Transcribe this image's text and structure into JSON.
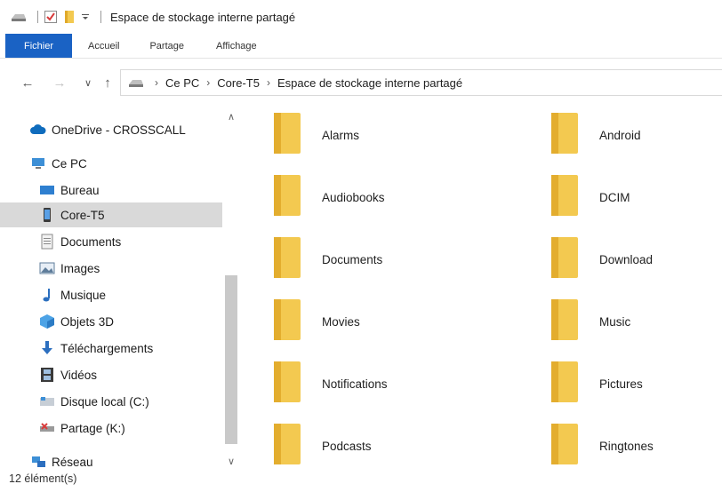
{
  "window": {
    "title": "Espace de stockage interne partagé",
    "quick_access": [
      "drive-icon",
      "properties-check-icon",
      "folder-icon",
      "customize-dropdown-icon"
    ]
  },
  "ribbon": {
    "tabs": [
      {
        "label": "Fichier",
        "active": true
      },
      {
        "label": "Accueil"
      },
      {
        "label": "Partage"
      },
      {
        "label": "Affichage"
      }
    ]
  },
  "address": {
    "crumbs": [
      "Ce PC",
      "Core-T5",
      "Espace de stockage interne partagé"
    ]
  },
  "nav": {
    "items": [
      {
        "label": "OneDrive - CROSSCALL",
        "icon": "onedrive-cloud-icon"
      },
      {
        "label": "Ce PC",
        "icon": "this-pc-icon"
      },
      {
        "label": "Bureau",
        "icon": "desktop-icon"
      },
      {
        "label": "Core-T5",
        "icon": "phone-icon",
        "selected": true
      },
      {
        "label": "Documents",
        "icon": "documents-icon"
      },
      {
        "label": "Images",
        "icon": "pictures-icon"
      },
      {
        "label": "Musique",
        "icon": "music-note-icon"
      },
      {
        "label": "Objets 3D",
        "icon": "3d-objects-icon"
      },
      {
        "label": "Téléchargements",
        "icon": "download-arrow-icon"
      },
      {
        "label": "Vidéos",
        "icon": "video-filmstrip-icon"
      },
      {
        "label": "Disque local (C:)",
        "icon": "local-disk-icon"
      },
      {
        "label": "Partage (K:)",
        "icon": "network-drive-disconnected-icon"
      },
      {
        "label": "Réseau",
        "icon": "network-icon"
      }
    ]
  },
  "content": {
    "folders": [
      "Alarms",
      "Android",
      "Audiobooks",
      "DCIM",
      "Documents",
      "Download",
      "Movies",
      "Music",
      "Notifications",
      "Pictures",
      "Podcasts",
      "Ringtones"
    ]
  },
  "status": {
    "count": "12 élément(s)"
  },
  "colors": {
    "file_tab": "#1a62c4",
    "folder": "#f3c950",
    "selection": "#d9d9d9"
  }
}
